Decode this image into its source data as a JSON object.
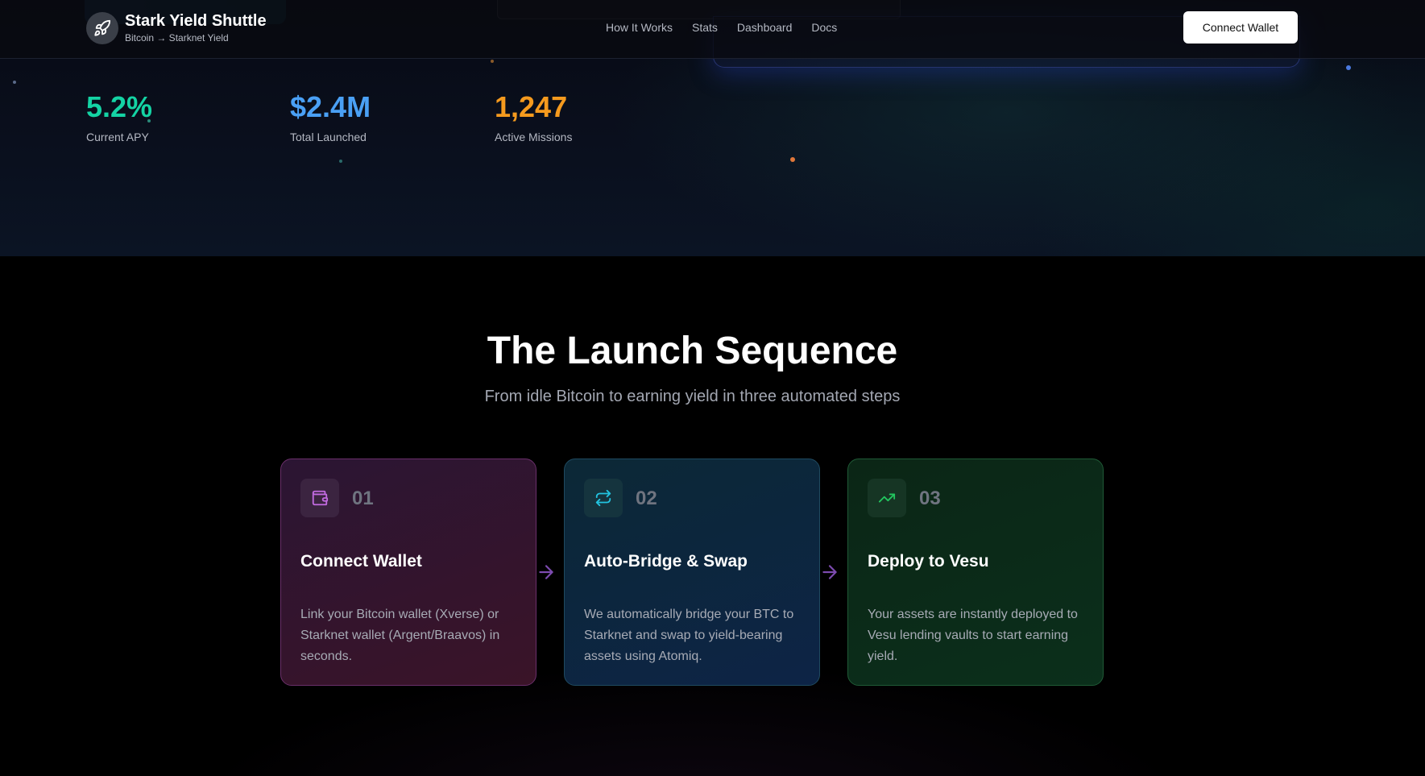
{
  "brand": {
    "name": "Stark Yield Shuttle",
    "subtitle": "Bitcoin → Starknet Yield"
  },
  "nav": {
    "items": [
      "How It Works",
      "Stats",
      "Dashboard",
      "Docs"
    ]
  },
  "header": {
    "connect_label": "Connect Wallet"
  },
  "stats": [
    {
      "value": "5.2%",
      "label": "Current APY",
      "color": "#14d3a4"
    },
    {
      "value": "$2.4M",
      "label": "Total Launched",
      "color": "#4aa0f5"
    },
    {
      "value": "1,247",
      "label": "Active Missions",
      "color": "#f59a1e"
    }
  ],
  "section": {
    "title": "The Launch Sequence",
    "subtitle": "From idle Bitcoin to earning yield in three automated steps"
  },
  "steps": [
    {
      "number": "01",
      "title": "Connect Wallet",
      "description": "Link your Bitcoin wallet (Xverse) or Starknet wallet (Argent/Braavos) in seconds.",
      "icon": "wallet-icon",
      "accent": "#c26be0"
    },
    {
      "number": "02",
      "title": "Auto-Bridge & Swap",
      "description": "We automatically bridge your BTC to Starknet and swap to yield-bearing assets using Atomiq.",
      "icon": "swap-icon",
      "accent": "#22c3e0"
    },
    {
      "number": "03",
      "title": "Deploy to Vesu",
      "description": "Your assets are instantly deployed to Vesu lending vaults to start earning yield.",
      "icon": "trending-up-icon",
      "accent": "#22c55e"
    }
  ]
}
